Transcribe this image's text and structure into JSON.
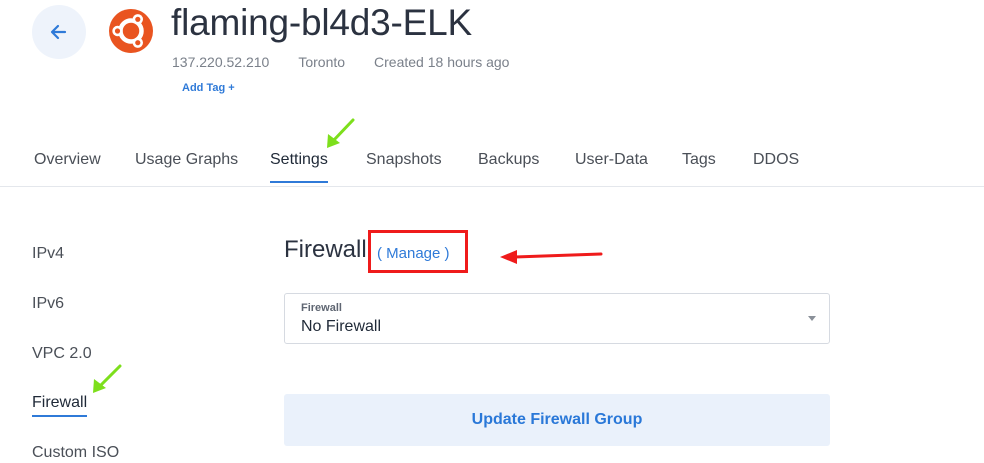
{
  "header": {
    "title": "flaming-bl4d3-ELK",
    "ip": "137.220.52.210",
    "location": "Toronto",
    "created": "Created 18 hours ago",
    "add_tag": "Add Tag +",
    "back_icon": "arrow-left-icon",
    "os_icon": "ubuntu-logo-icon"
  },
  "tabs": [
    {
      "label": "Overview"
    },
    {
      "label": "Usage Graphs"
    },
    {
      "label": "Settings",
      "active": true
    },
    {
      "label": "Snapshots"
    },
    {
      "label": "Backups"
    },
    {
      "label": "User-Data"
    },
    {
      "label": "Tags"
    },
    {
      "label": "DDOS"
    }
  ],
  "sidebar": {
    "items": [
      {
        "label": "IPv4"
      },
      {
        "label": "IPv6"
      },
      {
        "label": "VPC 2.0"
      },
      {
        "label": "Firewall",
        "active": true
      },
      {
        "label": "Custom ISO"
      }
    ]
  },
  "firewall": {
    "title": "Firewall",
    "manage_link": "( Manage )",
    "select_label": "Firewall",
    "select_value": "No Firewall",
    "update_button": "Update Firewall Group"
  },
  "colors": {
    "accent": "#2f7ad8",
    "annotation_red": "#ef1b1b",
    "annotation_green": "#7ddf1c"
  }
}
